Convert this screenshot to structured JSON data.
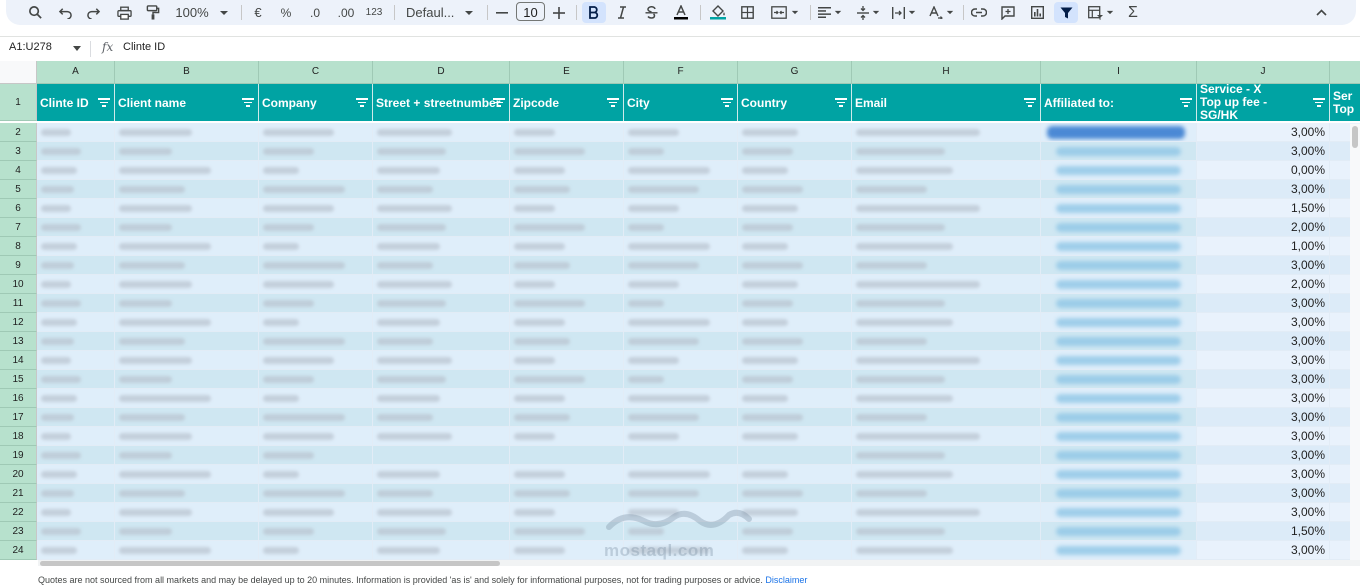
{
  "toolbar": {
    "zoom": "100%",
    "currency": "€",
    "percent": "%",
    "dec_decrease": ".0",
    "dec_increase": ".00",
    "format_123": "123",
    "font": "Defaul...",
    "font_size": "10"
  },
  "formula_bar": {
    "name_box": "A1:U278",
    "fx": "fx",
    "content": "Clinte ID"
  },
  "columns": [
    "A",
    "B",
    "C",
    "D",
    "E",
    "F",
    "G",
    "H",
    "I",
    "J"
  ],
  "headers": {
    "A": "Clinte ID",
    "B": "Client name",
    "C": "Company",
    "D": "Street + streetnumber",
    "E": "Zipcode",
    "F": "City",
    "G": "Country",
    "H": "Email",
    "I": "Affiliated to:",
    "J_line1": "Service - X",
    "J_line2": "Top up fee - SG/HK",
    "K_line1": "Ser",
    "K_line2": "Top"
  },
  "row_numbers": [
    "1",
    "2",
    "3",
    "4",
    "5",
    "6",
    "7",
    "8",
    "9",
    "10",
    "11",
    "12",
    "13",
    "14",
    "15",
    "16",
    "17",
    "18",
    "19",
    "20",
    "21",
    "22",
    "23",
    "24"
  ],
  "fees": [
    "3,00%",
    "3,00%",
    "0,00%",
    "3,00%",
    "1,50%",
    "2,00%",
    "1,00%",
    "3,00%",
    "2,00%",
    "3,00%",
    "3,00%",
    "3,00%",
    "3,00%",
    "3,00%",
    "3,00%",
    "3,00%",
    "3,00%",
    "3,00%",
    "3,00%",
    "3,00%",
    "3,00%",
    "1,50%",
    "3,00%"
  ],
  "footer": {
    "disclaimer": "Quotes are not sourced from all markets and may be delayed up to 20 minutes. Information is provided 'as is' and solely for informational purposes, not for trading purposes or advice.",
    "link": "Disclaimer"
  },
  "watermark": "mostaql.com",
  "colors": {
    "header_teal": "#00a3a3",
    "column_header_green": "#b7e1cd",
    "band_light": "#dfeefa",
    "band_blue": "#cfe7f2"
  }
}
